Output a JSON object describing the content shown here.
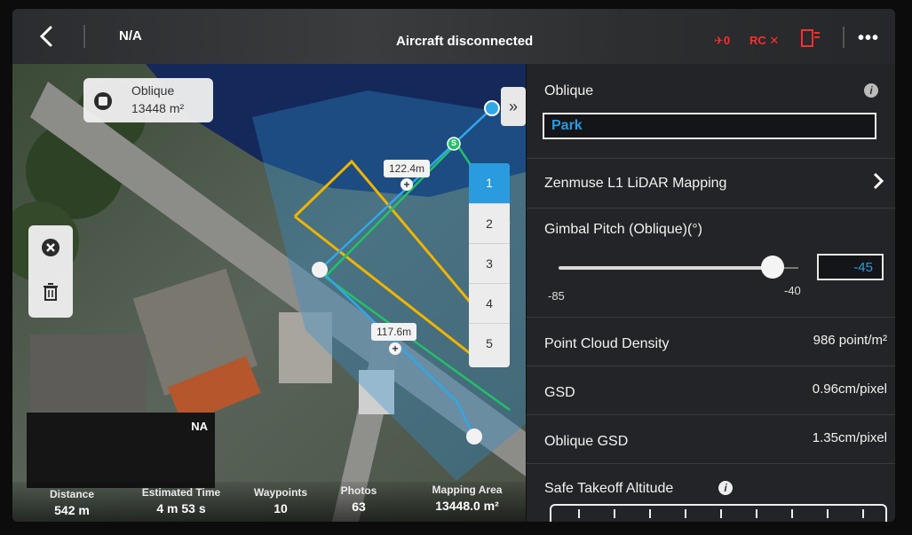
{
  "topbar": {
    "signal": "N/A",
    "status": "Aircraft disconnected",
    "drone_status": "✈0",
    "rc_status": "RC ✕",
    "more": "•••"
  },
  "map": {
    "area_card": {
      "name": "Oblique",
      "size": "13448 m²"
    },
    "distance_labels": [
      "122.4m",
      "117.6m"
    ],
    "start_marker": "S",
    "collapse_icon": "»",
    "waypoints": [
      "1",
      "2",
      "3",
      "4",
      "5"
    ],
    "selected_waypoint": "1"
  },
  "stats": {
    "camera_feed": "NA",
    "items": [
      {
        "label": "Distance",
        "value": "542 m"
      },
      {
        "label": "Estimated Time",
        "value": "4 m 53 s"
      },
      {
        "label": "Waypoints",
        "value": "10"
      },
      {
        "label": "Photos",
        "value": "63"
      },
      {
        "label": "Mapping Area",
        "value": "13448.0 m²"
      }
    ]
  },
  "panel": {
    "mission_type": "Oblique",
    "mission_name": "Park",
    "payload": "Zenmuse L1 LiDAR Mapping",
    "gimbal": {
      "label": "Gimbal Pitch (Oblique)(°)",
      "min_label": "-85",
      "max_label": "-40",
      "value": "-45"
    },
    "point_cloud": {
      "label": "Point Cloud Density",
      "value": "986 point/m²"
    },
    "gsd": {
      "label": "GSD",
      "value": "0.96cm/pixel"
    },
    "oblique_gsd": {
      "label": "Oblique GSD",
      "value": "1.35cm/pixel"
    },
    "safe_takeoff": {
      "label": "Safe Takeoff Altitude"
    }
  },
  "colors": {
    "accent": "#2a9bdf",
    "warning": "#ff2d2d",
    "route_yellow": "#f0b400",
    "route_green": "#22c06a",
    "route_blue": "#31a7e8"
  }
}
